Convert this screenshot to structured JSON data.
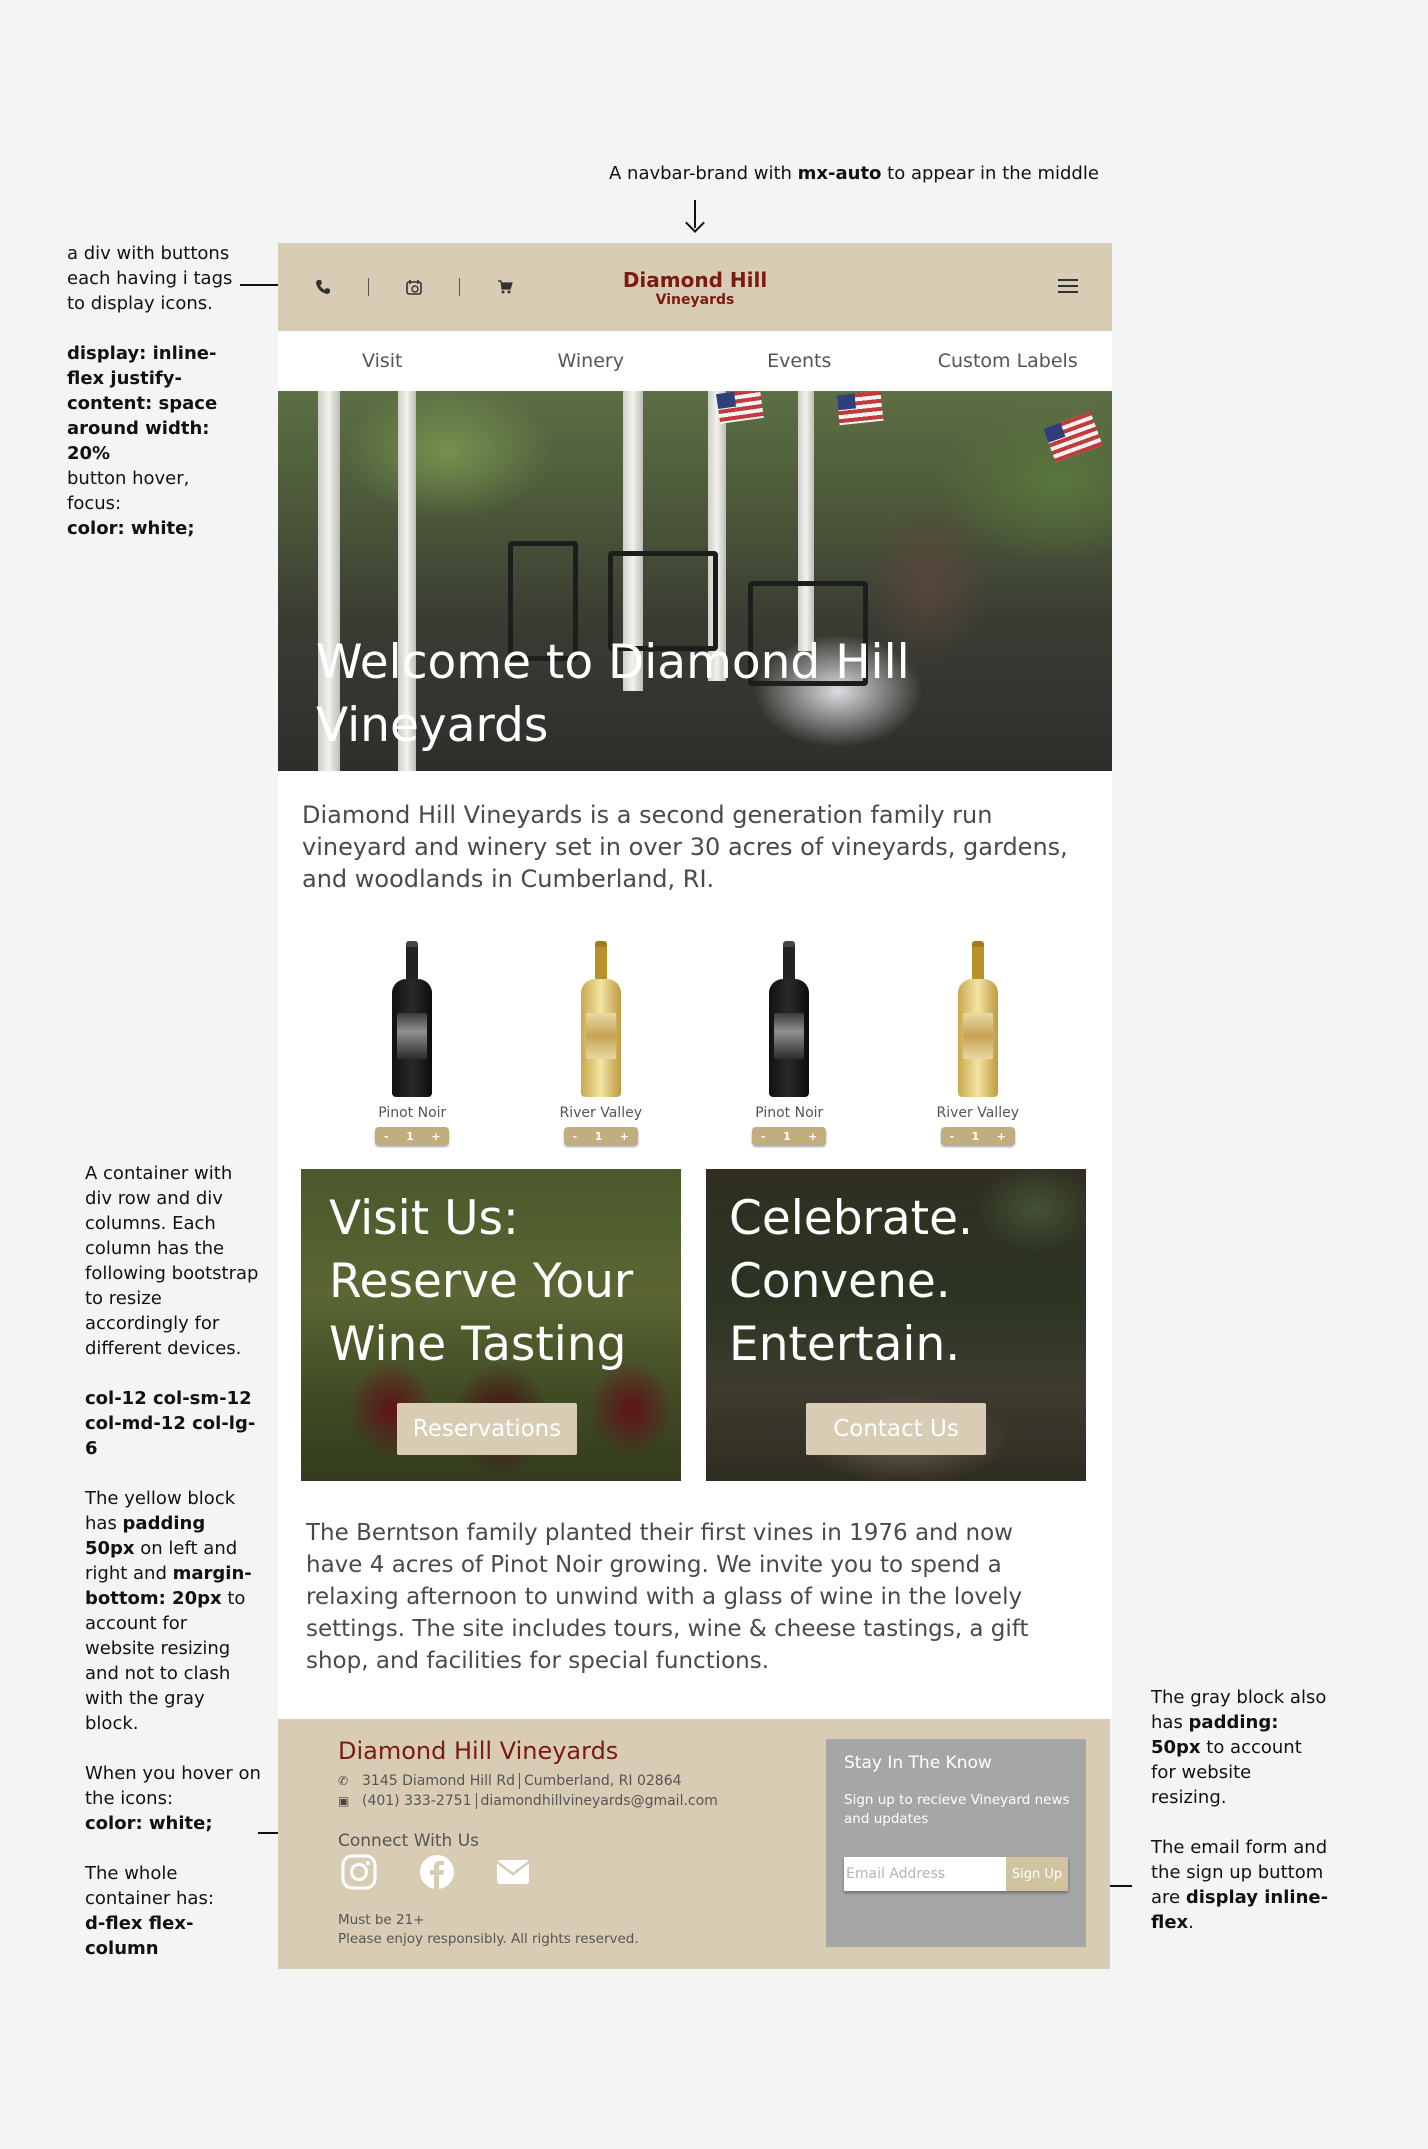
{
  "annotations": {
    "top_note_pre": "A navbar-brand with ",
    "top_note_bold": "mx-auto",
    "top_note_post": " to appear in the middle",
    "left_top_plain": "a div with buttons each having i tags to display icons.",
    "left_top_bold1": "display: inline-flex justify-content: space around width: 20%",
    "left_top_plain2": "button hover, focus:",
    "left_top_bold2": "color: white;",
    "left_mid_plain1": "A container with div row and div columns. Each column has the following bootstrap to resize accordingly for different devices.",
    "left_mid_bold1": "col-12 col-sm-12 col-md-12 col-lg-6",
    "left_mid_a": "The yellow block has ",
    "left_mid_b": "padding 50px",
    "left_mid_c": " on left and right and ",
    "left_mid_d": "margin-bottom: 20px",
    "left_mid_e": " to account for website resizing and not to clash with the gray block.",
    "left_bot_plain1": "When you hover on the icons:",
    "left_bot_bold1": "color: white;",
    "left_bot_plain2": "The whole container has:",
    "left_bot_bold2": "d-flex flex-column",
    "right_a": "The gray block also has ",
    "right_b": "padding: 50px",
    "right_c": " to account for website resizing.",
    "right_d": "The email form and the sign up buttom are ",
    "right_e": "display inline-flex",
    "right_f": "."
  },
  "site": {
    "brand_line1": "Diamond Hill",
    "brand_line2": "Vineyards",
    "nav": [
      "Visit",
      "Winery",
      "Events",
      "Custom Labels"
    ],
    "hero_title": "Welcome to Diamond Hill Vineyards",
    "intro": "Diamond Hill Vineyards is a second generation family run vineyard and winery set in over 30 acres of vineyards, gardens, and woodlands in Cumberland, RI.",
    "wines": [
      {
        "name": "Pinot Noir",
        "style": "red",
        "minus": "-",
        "qty": "1",
        "plus": "+"
      },
      {
        "name": "River Valley",
        "style": "white",
        "minus": "-",
        "qty": "1",
        "plus": "+"
      },
      {
        "name": "Pinot Noir",
        "style": "red",
        "minus": "-",
        "qty": "1",
        "plus": "+"
      },
      {
        "name": "River Valley",
        "style": "white",
        "minus": "-",
        "qty": "1",
        "plus": "+"
      }
    ],
    "card_visit_title": "Visit Us: Reserve Your Wine Tasting",
    "card_visit_button": "Reservations",
    "card_celebrate_title": "Celebrate. Convene. Entertain.",
    "card_celebrate_button": "Contact Us",
    "story": "The Berntson family planted their first vines in 1976 and now have 4 acres of Pinot Noir growing. We invite you to spend a relaxing afternoon to unwind with a glass of wine in the lovely settings. The site includes tours, wine & cheese tastings, a gift shop, and facilities for special functions.",
    "footer": {
      "title": "Diamond Hill Vineyards",
      "address": "3145 Diamond Hill Rd",
      "city": "Cumberland, RI 02864",
      "phone": "(401) 333-2751",
      "email": "diamondhillvineyards@gmail.com",
      "connect": "Connect With Us",
      "legal1": "Must be 21+",
      "legal2": "Please enjoy responsibly. All rights reserved.",
      "newsletter_title": "Stay In The Know",
      "newsletter_text": "Sign up to recieve Vineyard news and updates",
      "email_placeholder": "Email Address",
      "signup": "Sign Up"
    }
  },
  "colors": {
    "page_bg": "#f4f4f4",
    "tan": "#d8cdb4",
    "brand_red": "#7a1a10",
    "newsletter_gray": "#a6a6a6"
  },
  "icons": [
    "phone-icon",
    "clock-icon",
    "cart-icon",
    "menu-icon",
    "instagram-icon",
    "facebook-icon",
    "mail-icon",
    "phone-small-icon",
    "map-icon"
  ]
}
